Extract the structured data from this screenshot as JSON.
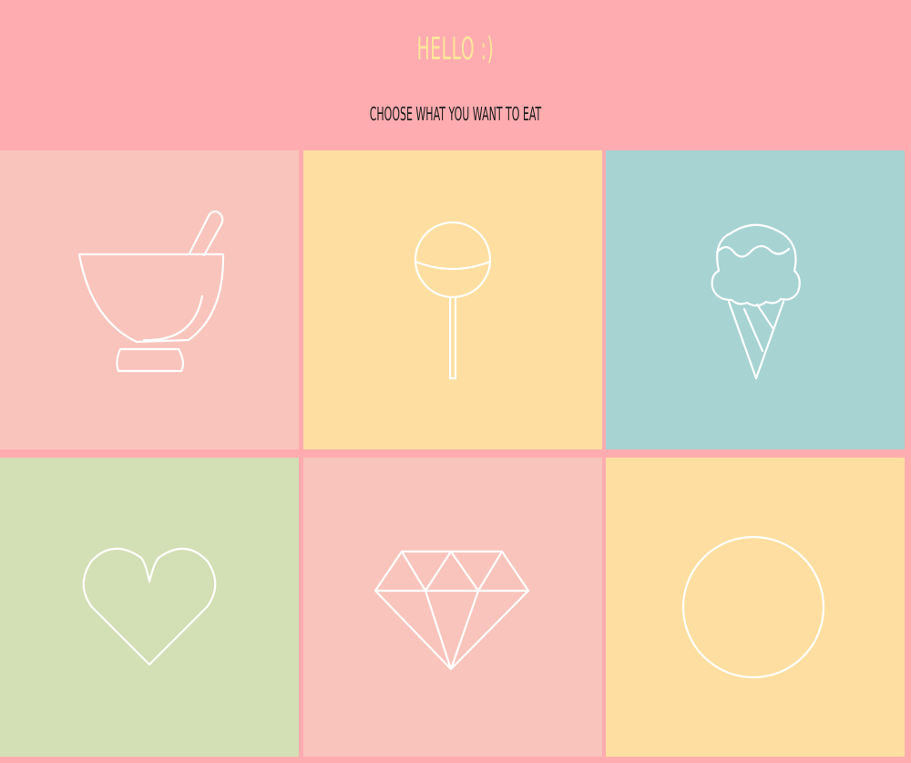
{
  "header": {
    "title": "HELLO :)",
    "subtitle": "CHOOSE WHAT YOU WANT TO EAT",
    "title_color": "#ffe79b",
    "background": "#ffacb0"
  },
  "tiles": [
    {
      "icon": "bowl-icon",
      "color": "#f9c4bc"
    },
    {
      "icon": "lollipop-icon",
      "color": "#fedfa1"
    },
    {
      "icon": "ice-cream-icon",
      "color": "#a7d3d3"
    },
    {
      "icon": "heart-icon",
      "color": "#d3dfb4"
    },
    {
      "icon": "diamond-icon",
      "color": "#f9c4bc"
    },
    {
      "icon": "circle-icon",
      "color": "#fedfa1"
    }
  ]
}
